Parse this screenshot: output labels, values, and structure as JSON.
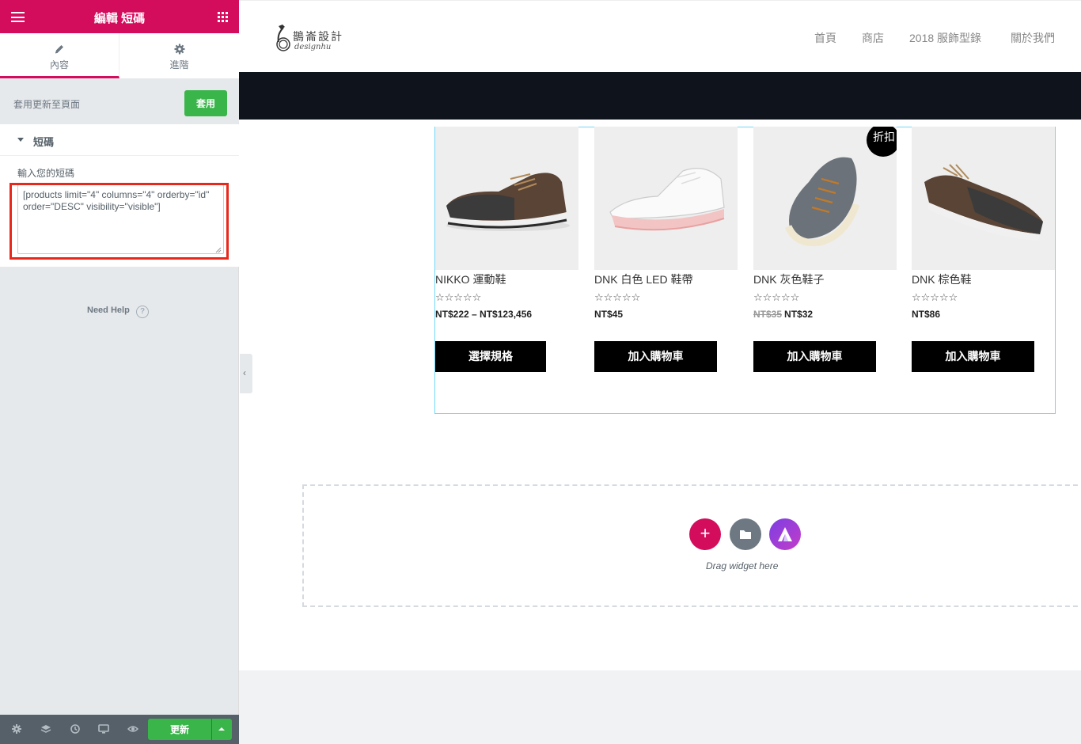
{
  "panel": {
    "title": "編輯 短碼",
    "tabs": [
      {
        "label": "內容",
        "icon": "pencil-icon",
        "active": true
      },
      {
        "label": "進階",
        "icon": "gear-icon",
        "active": false
      }
    ],
    "apply_text": "套用更新至頁面",
    "apply_button": "套用",
    "section_title": "短碼",
    "field_label": "輸入您的短碼",
    "shortcode_value": "[products limit=\"4\" columns=\"4\" orderby=\"id\" order=\"DESC\" visibility=\"visible\"]",
    "need_help": "Need Help",
    "help_glyph": "?",
    "update_button": "更新",
    "accent": "#d30c5c",
    "success": "#39b54a"
  },
  "site": {
    "logo_cn": "鵲崙設計",
    "logo_en": "designhu",
    "nav": [
      "首頁",
      "商店",
      "2018 服飾型錄",
      "關於我們"
    ]
  },
  "products": [
    {
      "name": "NIKKO 運動鞋",
      "stars": "☆☆☆☆☆",
      "price": "NT$222 – NT$123,456",
      "old_price": "",
      "button": "選擇規格",
      "badge": ""
    },
    {
      "name": "DNK 白色 LED 鞋帶",
      "stars": "☆☆☆☆☆",
      "price": "NT$45",
      "old_price": "",
      "button": "加入購物車",
      "badge": ""
    },
    {
      "name": "DNK 灰色鞋子",
      "stars": "☆☆☆☆☆",
      "price": "NT$32",
      "old_price": "NT$35",
      "button": "加入購物車",
      "badge": "折扣"
    },
    {
      "name": "DNK 棕色鞋",
      "stars": "☆☆☆☆☆",
      "price": "NT$86",
      "old_price": "",
      "button": "加入購物車",
      "badge": ""
    }
  ],
  "drop_zone": {
    "text": "Drag widget here",
    "add_glyph": "+",
    "buttons": [
      "add-section",
      "template-library",
      "astra"
    ]
  }
}
